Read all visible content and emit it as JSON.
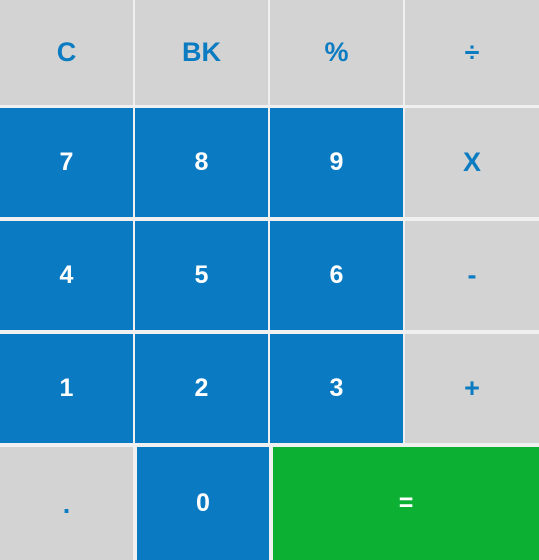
{
  "colors": {
    "function_key_bg": "#d3d3d3",
    "function_key_text": "#0b7bc2",
    "digit_key_bg": "#0a7bc2",
    "digit_key_text": "#ffffff",
    "equals_key_bg": "#0cb032",
    "gap": "#f0f0f0"
  },
  "keys": {
    "clear": "C",
    "backspace": "BK",
    "percent": "%",
    "divide": "÷",
    "seven": "7",
    "eight": "8",
    "nine": "9",
    "multiply": "X",
    "four": "4",
    "five": "5",
    "six": "6",
    "subtract": "-",
    "one": "1",
    "two": "2",
    "three": "3",
    "add": "+",
    "decimal": ".",
    "zero": "0",
    "equals": "="
  }
}
